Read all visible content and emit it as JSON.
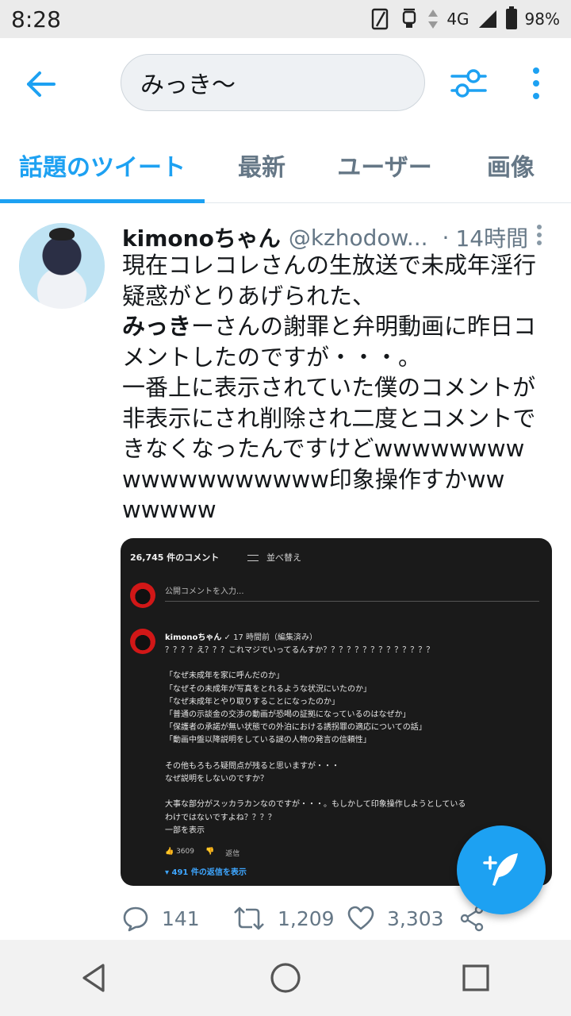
{
  "status_bar": {
    "time": "8:28",
    "network": "4G",
    "battery": "98%"
  },
  "search": {
    "query": "みっき〜"
  },
  "tabs": [
    {
      "label": "話題のツイート",
      "active": true
    },
    {
      "label": "最新"
    },
    {
      "label": "ユーザー"
    },
    {
      "label": "画像"
    }
  ],
  "tweet": {
    "name": "kimonoちゃん",
    "handle": "@kzhodow...",
    "dot": "·",
    "time": "14時間",
    "lines": [
      "現在コレコレさんの生放送で未成年淫行",
      "疑惑がとりあげられた、",
      "ーさんの謝罪と弁明動画に昨日コ",
      "メントしたのですが・・・。",
      "一番上に表示されていた僕のコメントが",
      "非表示にされ削除され二度とコメントで",
      "きなくなったんですけどwwwwwwww",
      "wwwwwwwwwww印象操作すかww",
      "wwwww"
    ],
    "highlight": "みっき",
    "replies": "141",
    "retweets": "1,209",
    "likes": "3,303"
  },
  "media": {
    "comment_count": "26,745 件のコメント",
    "sort_label": "並べ替え",
    "input_placeholder": "公開コメントを入力...",
    "comment_author": "kimonoちゃん",
    "comment_meta": "✓ 17 時間前（編集済み）",
    "comment_lines": [
      "？？？？え？？？これマジでいってるんすか？？？？？？？？？？？？？？",
      "",
      "「なぜ未成年を家に呼んだのか」",
      "「なぜその未成年が写真をとれるような状況にいたのか」",
      "「なぜ未成年とやり取りすることになったのか」",
      "「普通の示談金の交渉の動画が恐喝の証拠になっているのはなぜか」",
      "「保護者の承諾が無い状態での外泊における誘拐罪の適応についての話」",
      "「動画中盤以降説明をしている謎の人物の発言の信頼性」",
      "",
      "その他もろもろ疑問点が残ると思いますが・・・",
      "なぜ説明をしないのですか？",
      "",
      "大事な部分がスッカラカンなのですが・・・。もしかして印象操作しようとしている",
      "わけではないですよね？？？？",
      "一部を表示"
    ],
    "like_count": "3609",
    "reply_label": "返信",
    "view_replies": "491 件の返信を表示"
  },
  "colors": {
    "accent": "#1da1f2",
    "muted": "#657786",
    "text": "#14171a"
  }
}
